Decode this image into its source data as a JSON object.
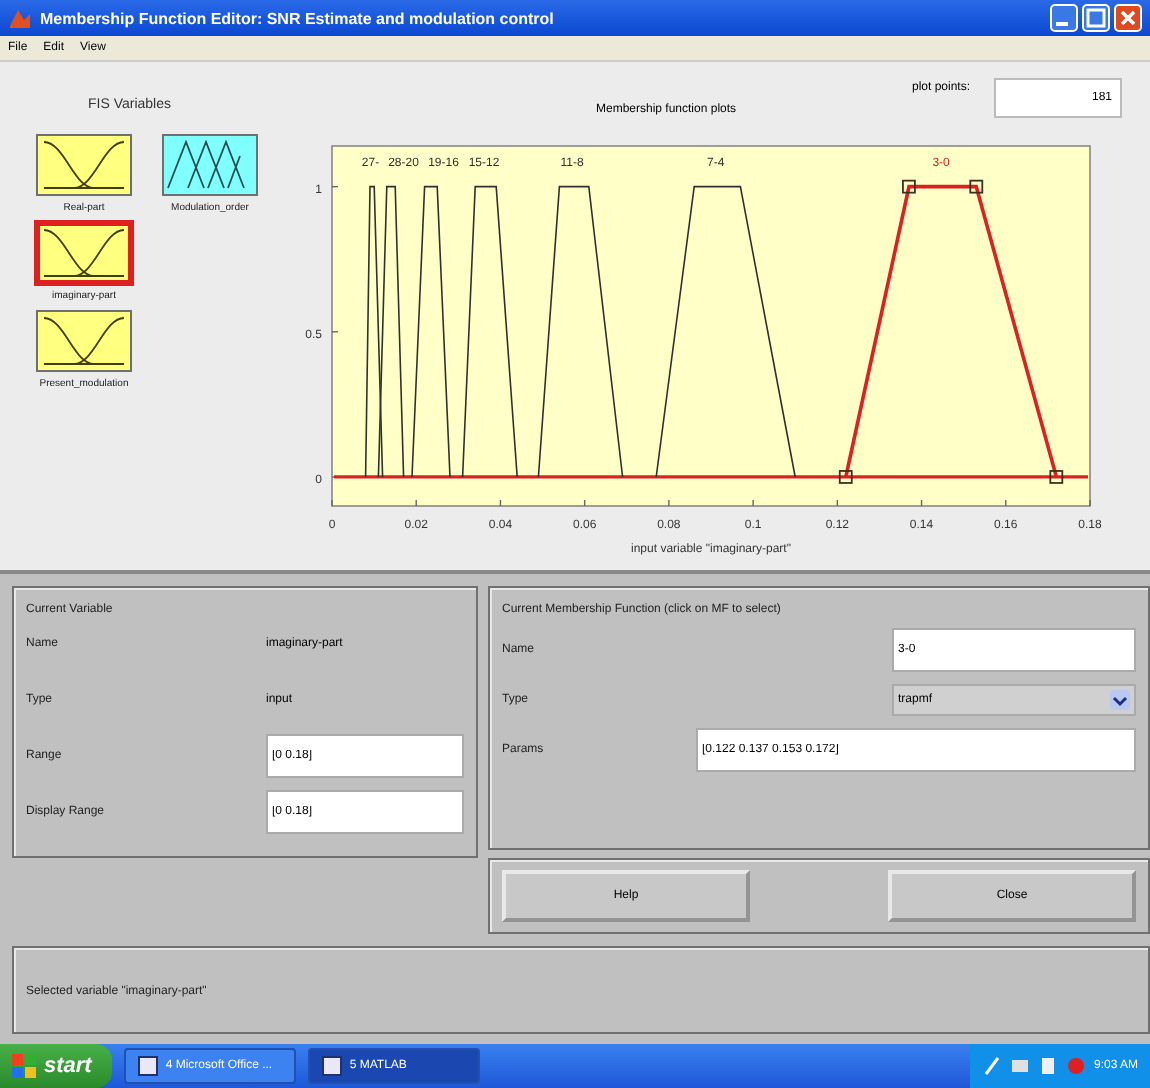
{
  "window": {
    "title": "Membership Function Editor: SNR Estimate and modulation control"
  },
  "menu": [
    "File",
    "Edit",
    "View"
  ],
  "fis_variables": {
    "title": "FIS Variables",
    "items": [
      {
        "name": "Real-part",
        "kind": "input",
        "selected": false
      },
      {
        "name": "Modulation_order",
        "kind": "output",
        "selected": false
      },
      {
        "name": "imaginary-part",
        "kind": "input",
        "selected": true
      },
      {
        "name": "Present_modulation",
        "kind": "input",
        "selected": false
      }
    ]
  },
  "plot": {
    "title": "Membership function plots",
    "plot_points_label": "plot points:",
    "plot_points": "181",
    "chart_data": {
      "type": "line",
      "xlabel": "input variable \"imaginary-part\"",
      "xlim": [
        0,
        0.18
      ],
      "ylim": [
        -0.1,
        1.14
      ],
      "xticks": [
        0,
        0.02,
        0.04,
        0.06,
        0.08,
        0.1,
        0.12,
        0.14,
        0.16,
        0.18
      ],
      "yticks": [
        0,
        0.5,
        1
      ],
      "series": [
        {
          "name": "27-",
          "color": "#303030",
          "x": [
            0.008,
            0.009,
            0.01,
            0.012
          ],
          "values": [
            0,
            1,
            1,
            0
          ]
        },
        {
          "name": "28-20",
          "color": "#303030",
          "x": [
            0.011,
            0.013,
            0.015,
            0.017
          ],
          "values": [
            0,
            1,
            1,
            0
          ]
        },
        {
          "name": "19-16",
          "color": "#303030",
          "x": [
            0.019,
            0.022,
            0.025,
            0.028
          ],
          "values": [
            0,
            1,
            1,
            0
          ]
        },
        {
          "name": "15-12",
          "color": "#303030",
          "x": [
            0.031,
            0.034,
            0.039,
            0.044
          ],
          "values": [
            0,
            1,
            1,
            0
          ]
        },
        {
          "name": "11-8",
          "color": "#303030",
          "x": [
            0.049,
            0.054,
            0.061,
            0.069
          ],
          "values": [
            0,
            1,
            1,
            0
          ]
        },
        {
          "name": "7-4",
          "color": "#303030",
          "x": [
            0.077,
            0.086,
            0.097,
            0.11
          ],
          "values": [
            0,
            1,
            1,
            0
          ]
        },
        {
          "name": "3-0",
          "color": "#e02020",
          "marker": "square",
          "x": [
            0.122,
            0.137,
            0.153,
            0.172
          ],
          "values": [
            0,
            1,
            1,
            0
          ]
        }
      ],
      "ref_lines": [
        {
          "axis": "y",
          "value": 0,
          "color": "#e02020"
        }
      ]
    }
  },
  "current_variable": {
    "title": "Current Variable",
    "fields": [
      {
        "label": "Name",
        "value": "imaginary-part",
        "kind": "text"
      },
      {
        "label": "Type",
        "value": "input",
        "kind": "text"
      },
      {
        "label": "Range",
        "value": "[0 0.18]",
        "kind": "input"
      },
      {
        "label": "Display Range",
        "value": "[0 0.18]",
        "kind": "input"
      }
    ]
  },
  "current_mf": {
    "title": "Current Membership Function (click on MF to select)",
    "name_label": "Name",
    "name": "3-0",
    "type_label": "Type",
    "type": "trapmf",
    "params_label": "Params",
    "params": "[0.122 0.137 0.153 0.172]"
  },
  "buttons": [
    "Help",
    "Close"
  ],
  "status": "Selected variable \"imaginary-part\"",
  "taskbar": {
    "start": "start",
    "tasks": [
      {
        "label": "4 Microsoft Office ...",
        "selected": false
      },
      {
        "label": "5 MATLAB",
        "selected": true
      }
    ],
    "clock": "9:03 AM"
  }
}
